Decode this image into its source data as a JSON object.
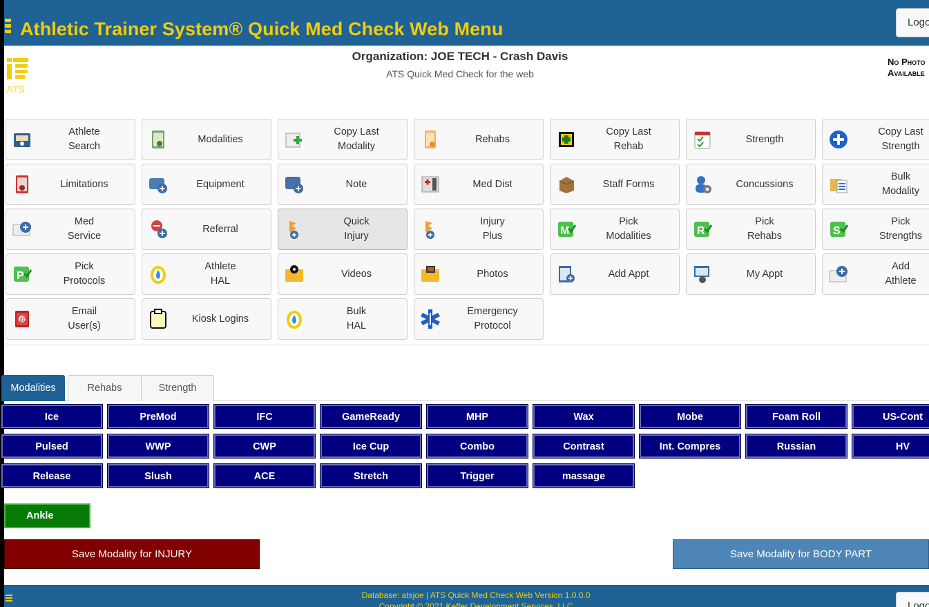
{
  "header": {
    "title": "Athletic Trainer System® Quick Med Check Web Menu",
    "logout": "Logout"
  },
  "org": {
    "title": "Organization: JOE TECH -  Crash Davis",
    "subtitle": "ATS Quick Med Check for the web",
    "photo": "No Photo Available"
  },
  "tiles": [
    {
      "label": "Athlete\nSearch",
      "icon": "athlete-search-icon"
    },
    {
      "label": "Modalities",
      "icon": "modalities-icon"
    },
    {
      "label": "Copy Last\nModality",
      "icon": "copy-last-modality-icon"
    },
    {
      "label": "Rehabs",
      "icon": "rehabs-icon"
    },
    {
      "label": "Copy Last\nRehab",
      "icon": "copy-last-rehab-icon"
    },
    {
      "label": "Strength",
      "icon": "strength-icon"
    },
    {
      "label": "Copy Last\nStrength",
      "icon": "copy-last-strength-icon"
    },
    {
      "label": "Limitations",
      "icon": "limitations-icon"
    },
    {
      "label": "Equipment",
      "icon": "equipment-icon"
    },
    {
      "label": "Note",
      "icon": "note-icon"
    },
    {
      "label": "Med Dist",
      "icon": "med-dist-icon"
    },
    {
      "label": "Staff Forms",
      "icon": "staff-forms-icon"
    },
    {
      "label": "Concussions",
      "icon": "concussions-icon"
    },
    {
      "label": "Bulk\nModality",
      "icon": "bulk-modality-icon"
    },
    {
      "label": "Med\nService",
      "icon": "med-service-icon"
    },
    {
      "label": "Referral",
      "icon": "referral-icon"
    },
    {
      "label": "Quick\nInjury",
      "icon": "quick-injury-icon",
      "active": true
    },
    {
      "label": "Injury\nPlus",
      "icon": "injury-plus-icon"
    },
    {
      "label": "Pick\nModalities",
      "icon": "pick-modalities-icon"
    },
    {
      "label": "Pick\nRehabs",
      "icon": "pick-rehabs-icon"
    },
    {
      "label": "Pick\nStrengths",
      "icon": "pick-strengths-icon"
    },
    {
      "label": "Pick\nProtocols",
      "icon": "pick-protocols-icon"
    },
    {
      "label": "Athlete\nHAL",
      "icon": "athlete-hal-icon"
    },
    {
      "label": "Videos",
      "icon": "videos-icon"
    },
    {
      "label": "Photos",
      "icon": "photos-icon"
    },
    {
      "label": "Add Appt",
      "icon": "add-appt-icon"
    },
    {
      "label": "My Appt",
      "icon": "my-appt-icon"
    },
    {
      "label": "Add\nAthlete",
      "icon": "add-athlete-icon"
    },
    {
      "label": "Email\nUser(s)",
      "icon": "email-users-icon"
    },
    {
      "label": "Kiosk Logins",
      "icon": "kiosk-logins-icon"
    },
    {
      "label": "Bulk\nHAL",
      "icon": "bulk-hal-icon"
    },
    {
      "label": "Emergency\nProtocol",
      "icon": "emergency-protocol-icon"
    }
  ],
  "tabs": [
    {
      "label": "Modalities",
      "active": true
    },
    {
      "label": "Rehabs",
      "active": false
    },
    {
      "label": "Strength",
      "active": false
    }
  ],
  "modalities": [
    "Ice",
    "PreMod",
    "IFC",
    "GameReady",
    "MHP",
    "Wax",
    "Mobe",
    "Foam Roll",
    "US-Cont",
    "Pulsed",
    "WWP",
    "CWP",
    "Ice Cup",
    "Combo",
    "Contrast",
    "Int. Compres",
    "Russian",
    "HV",
    "Release",
    "Slush",
    "ACE",
    "Stretch",
    "Trigger",
    "massage"
  ],
  "body_part": "Ankle",
  "actions": {
    "save_injury": "Save Modality for INJURY",
    "save_body_part": "Save Modality for BODY PART"
  },
  "footer": {
    "line1": "Database: atsjoe | ATS Quick Med Check Web Version 1.0.0.0",
    "line2": "Copyright © 2021  Keffer Development Services, LLC",
    "logout": "Logout"
  },
  "colors": {
    "header_bg": "#1f6296",
    "title_yellow": "#f3cd05",
    "modality_btn": "#000080",
    "body_part_btn": "#087a08",
    "save_injury": "#800000",
    "save_body": "#4d86b6"
  }
}
